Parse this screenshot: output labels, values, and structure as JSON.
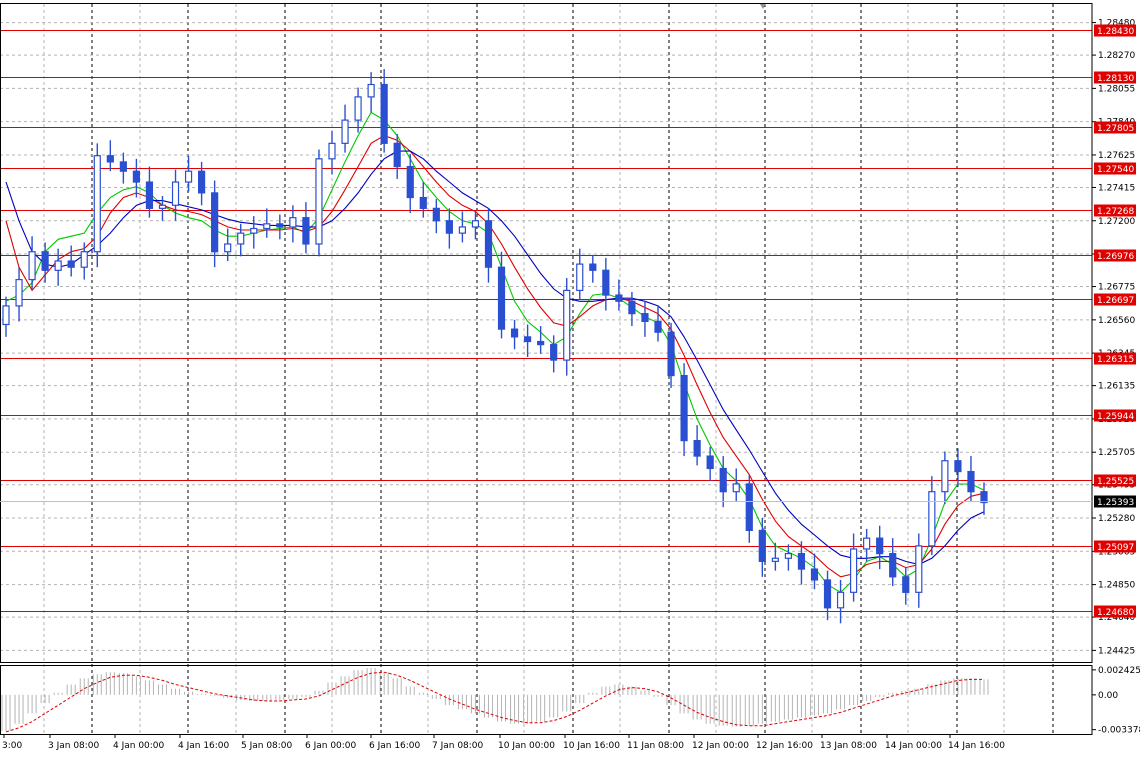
{
  "chart_data": {
    "type": "candlestick",
    "instrument_levels": [
      "1.28430",
      "1.28130",
      "1.27805",
      "1.27540",
      "1.27268",
      "1.26976",
      "1.26697",
      "1.26315",
      "1.25944",
      "1.25525",
      "1.25097",
      "1.24680"
    ],
    "current_price": "1.25393",
    "y_ticks": [
      "1.28480",
      "1.28270",
      "1.28055",
      "1.27840",
      "1.27625",
      "1.27415",
      "1.27200",
      "1.26985",
      "1.26775",
      "1.26560",
      "1.26345",
      "1.26135",
      "1.25920",
      "1.25705",
      "1.25495",
      "1.25280",
      "1.25065",
      "1.24850",
      "1.24640",
      "1.24425"
    ],
    "y_range": [
      1.2435,
      1.286
    ],
    "x_labels": [
      "3:00",
      "3 Jan 08:00",
      "4 Jan 00:00",
      "4 Jan 16:00",
      "5 Jan 08:00",
      "6 Jan 00:00",
      "6 Jan 16:00",
      "7 Jan 08:00",
      "10 Jan 00:00",
      "10 Jan 16:00",
      "11 Jan 08:00",
      "12 Jan 00:00",
      "12 Jan 16:00",
      "13 Jan 08:00",
      "14 Jan 00:00",
      "14 Jan 16:00"
    ],
    "closes": [
      1.2665,
      1.2682,
      1.27,
      1.2688,
      1.2694,
      1.269,
      1.27,
      1.2762,
      1.2758,
      1.2752,
      1.2745,
      1.2728,
      1.273,
      1.2745,
      1.2752,
      1.2738,
      1.27,
      1.2705,
      1.2712,
      1.2715,
      1.2718,
      1.2716,
      1.2722,
      1.2705,
      1.276,
      1.277,
      1.2785,
      1.28,
      1.2808,
      1.277,
      1.2755,
      1.2735,
      1.2728,
      1.272,
      1.2712,
      1.2716,
      1.272,
      1.269,
      1.265,
      1.2645,
      1.2642,
      1.264,
      1.263,
      1.2675,
      1.2692,
      1.2688,
      1.2672,
      1.2668,
      1.266,
      1.2655,
      1.2648,
      1.262,
      1.2578,
      1.2568,
      1.256,
      1.2545,
      1.255,
      1.252,
      1.25,
      1.2502,
      1.2505,
      1.2495,
      1.2488,
      1.247,
      1.248,
      1.2508,
      1.2515,
      1.2505,
      1.249,
      1.248,
      1.251,
      1.2545,
      1.2565,
      1.2558,
      1.2545,
      1.2538
    ],
    "moving_averages": [
      {
        "color": "#00c800",
        "values": [
          1.2668,
          1.2672,
          1.268,
          1.27,
          1.2708,
          1.271,
          1.2712,
          1.2725,
          1.2735,
          1.274,
          1.2742,
          1.2738,
          1.273,
          1.2725,
          1.2722,
          1.272,
          1.2714,
          1.271,
          1.271,
          1.2712,
          1.2714,
          1.2715,
          1.2716,
          1.2712,
          1.2722,
          1.274,
          1.2758,
          1.2775,
          1.279,
          1.2785,
          1.2775,
          1.276,
          1.2745,
          1.2735,
          1.2726,
          1.272,
          1.2718,
          1.2712,
          1.269,
          1.2668,
          1.2655,
          1.2648,
          1.264,
          1.2645,
          1.266,
          1.2672,
          1.2673,
          1.267,
          1.2664,
          1.2658,
          1.2654,
          1.264,
          1.2615,
          1.2592,
          1.2575,
          1.256,
          1.2552,
          1.254,
          1.2522,
          1.251,
          1.2506,
          1.2502,
          1.2496,
          1.2485,
          1.248,
          1.2488,
          1.25,
          1.2503,
          1.2498,
          1.249,
          1.2495,
          1.2515,
          1.2538,
          1.255,
          1.255,
          1.2546
        ]
      },
      {
        "color": "#e00000",
        "values": [
          1.272,
          1.269,
          1.2675,
          1.2685,
          1.2695,
          1.27,
          1.2702,
          1.271,
          1.2725,
          1.2735,
          1.2738,
          1.2735,
          1.273,
          1.2727,
          1.2726,
          1.2724,
          1.272,
          1.2716,
          1.2714,
          1.2714,
          1.2714,
          1.2714,
          1.2715,
          1.2713,
          1.2716,
          1.2726,
          1.274,
          1.2755,
          1.277,
          1.2775,
          1.2772,
          1.2765,
          1.2755,
          1.2745,
          1.2736,
          1.273,
          1.2726,
          1.2718,
          1.2705,
          1.269,
          1.2676,
          1.2664,
          1.2654,
          1.2652,
          1.2658,
          1.2665,
          1.2669,
          1.267,
          1.2668,
          1.2664,
          1.266,
          1.265,
          1.2633,
          1.2614,
          1.2596,
          1.258,
          1.2568,
          1.2556,
          1.254,
          1.2526,
          1.2516,
          1.251,
          1.2504,
          1.2496,
          1.249,
          1.2492,
          1.2498,
          1.25,
          1.25,
          1.2496,
          1.2498,
          1.2508,
          1.2524,
          1.2536,
          1.2542,
          1.2544
        ]
      },
      {
        "color": "#0000c0",
        "values": [
          1.2745,
          1.272,
          1.27,
          1.2692,
          1.269,
          1.2692,
          1.2698,
          1.2704,
          1.2712,
          1.2722,
          1.273,
          1.2733,
          1.2733,
          1.2731,
          1.2729,
          1.2727,
          1.2724,
          1.2721,
          1.2719,
          1.2718,
          1.2717,
          1.2717,
          1.2717,
          1.2716,
          1.2716,
          1.272,
          1.2728,
          1.2738,
          1.275,
          1.276,
          1.2765,
          1.2765,
          1.276,
          1.2752,
          1.2745,
          1.2738,
          1.2733,
          1.2728,
          1.272,
          1.271,
          1.2698,
          1.2686,
          1.2676,
          1.267,
          1.2668,
          1.2668,
          1.2669,
          1.267,
          1.267,
          1.2668,
          1.2665,
          1.2658,
          1.2645,
          1.263,
          1.2614,
          1.2598,
          1.2585,
          1.2572,
          1.2558,
          1.2544,
          1.2533,
          1.2524,
          1.2517,
          1.251,
          1.2504,
          1.2502,
          1.2502,
          1.2503,
          1.2503,
          1.25,
          1.2498,
          1.2502,
          1.251,
          1.252,
          1.2528,
          1.2532
        ]
      }
    ],
    "oscillator": {
      "ticks": [
        "0.002425",
        "0.00",
        "-0.003378"
      ],
      "range": [
        -0.0038,
        0.0028
      ],
      "histogram": [
        -0.0035,
        -0.0028,
        -0.0018,
        -0.0008,
        0.0002,
        0.001,
        0.0016,
        0.002,
        0.0022,
        0.0021,
        0.0018,
        0.0014,
        0.001,
        0.0006,
        0.0003,
        0.0001,
        -0.0001,
        -0.0003,
        -0.0005,
        -0.0006,
        -0.0006,
        -0.0005,
        -0.0004,
        -0.0002,
        0.0004,
        0.0012,
        0.0018,
        0.0024,
        0.0026,
        0.0022,
        0.0016,
        0.0008,
        0.0002,
        -0.0004,
        -0.001,
        -0.0014,
        -0.0018,
        -0.0022,
        -0.0026,
        -0.0028,
        -0.0028,
        -0.0026,
        -0.0022,
        -0.0016,
        -0.0008,
        0.0002,
        0.0008,
        0.001,
        0.0008,
        0.0004,
        -0.0002,
        -0.001,
        -0.0018,
        -0.0024,
        -0.0028,
        -0.003,
        -0.0031,
        -0.003,
        -0.0028,
        -0.0026,
        -0.0024,
        -0.0022,
        -0.002,
        -0.0018,
        -0.0014,
        -0.001,
        -0.0006,
        -0.0002,
        0.0002,
        0.0004,
        0.0006,
        0.001,
        0.0014,
        0.0016,
        0.0016,
        0.0015
      ],
      "signal": [
        -0.0036,
        -0.0032,
        -0.0026,
        -0.0018,
        -0.001,
        -0.0002,
        0.0006,
        0.0012,
        0.0017,
        0.0019,
        0.0019,
        0.0017,
        0.0014,
        0.001,
        0.0007,
        0.0004,
        0.0001,
        -0.0001,
        -0.0003,
        -0.0005,
        -0.0006,
        -0.0006,
        -0.0005,
        -0.0004,
        -0.0001,
        0.0005,
        0.0011,
        0.0017,
        0.0021,
        0.0022,
        0.0019,
        0.0014,
        0.0008,
        0.0002,
        -0.0004,
        -0.0009,
        -0.0014,
        -0.0018,
        -0.0022,
        -0.0025,
        -0.0027,
        -0.0027,
        -0.0025,
        -0.0021,
        -0.0015,
        -0.0008,
        -0.0001,
        0.0005,
        0.0007,
        0.0006,
        0.0003,
        -0.0003,
        -0.001,
        -0.0017,
        -0.0022,
        -0.0026,
        -0.0029,
        -0.003,
        -0.003,
        -0.0028,
        -0.0026,
        -0.0024,
        -0.0022,
        -0.002,
        -0.0017,
        -0.0013,
        -0.0009,
        -0.0005,
        -0.0001,
        0.0002,
        0.0005,
        0.0008,
        0.0011,
        0.0014,
        0.0015,
        0.0015
      ]
    },
    "grid": true,
    "colors": {
      "candle": "#2b4fd1",
      "level_line": "#e00000",
      "level_label_bg": "#e00000",
      "price_label_bg": "#000000",
      "grid": "#b4b4b4",
      "grid_dark": "#000000",
      "histogram": "#b4b4b4",
      "signal": "#e00000"
    }
  }
}
